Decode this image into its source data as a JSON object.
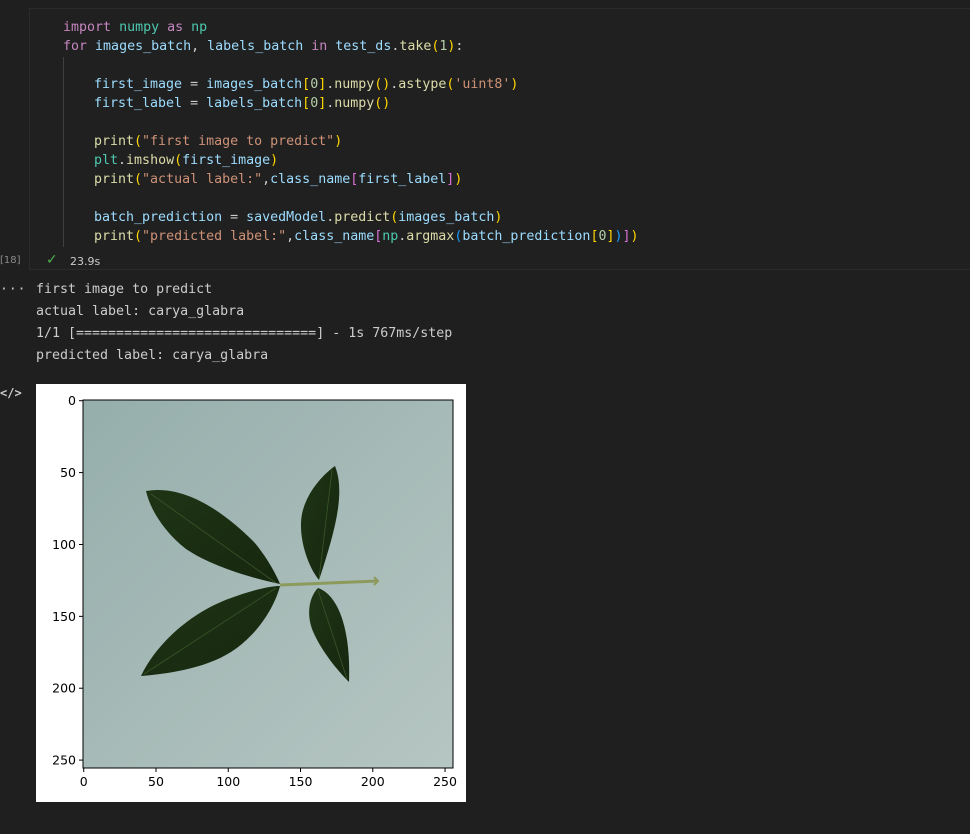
{
  "cell": {
    "execution_count": "[18]",
    "status_icon": "check-icon",
    "duration": "23.9s"
  },
  "code": {
    "l1": {
      "kw1": "import",
      "mod": "numpy",
      "kw2": "as",
      "alias": "np"
    },
    "l2": {
      "kw1": "for",
      "v1": "images_batch",
      "comma": ",",
      "v2": "labels_batch",
      "kw2": "in",
      "v3": "test_ds",
      "fn": "take",
      "num": "1",
      "end": ":"
    },
    "l3": {
      "v1": "first_image",
      "eq": " = ",
      "v2": "images_batch",
      "idx": "0",
      "fn1": "numpy",
      "fn2": "astype",
      "str": "'uint8'"
    },
    "l4": {
      "v1": "first_label",
      "eq": " = ",
      "v2": "labels_batch",
      "idx": "0",
      "fn1": "numpy"
    },
    "l5": {
      "fn": "print",
      "str": "\"first image to predict\""
    },
    "l6": {
      "mod": "plt",
      "fn": "imshow",
      "v": "first_image"
    },
    "l7": {
      "fn": "print",
      "str": "\"actual label:\"",
      "v1": "class_name",
      "v2": "first_label"
    },
    "l8": {
      "v1": "batch_prediction",
      "eq": " = ",
      "v2": "savedModel",
      "fn": "predict",
      "v3": "images_batch"
    },
    "l9": {
      "fn": "print",
      "str": "\"predicted label:\"",
      "v1": "class_name",
      "mod": "np",
      "fn2": "argmax",
      "v2": "batch_prediction",
      "idx": "0"
    }
  },
  "output": {
    "more_icon": "ellipsis-icon",
    "lines": [
      "first image to predict",
      "actual label: carya_glabra",
      "1/1 [==============================] - 1s 767ms/step",
      "predicted label: carya_glabra"
    ],
    "figure_icon": "code-icon",
    "x_ticks": [
      "0",
      "50",
      "100",
      "150",
      "200",
      "250"
    ],
    "y_ticks": [
      "0",
      "50",
      "100",
      "150",
      "200",
      "250"
    ]
  }
}
